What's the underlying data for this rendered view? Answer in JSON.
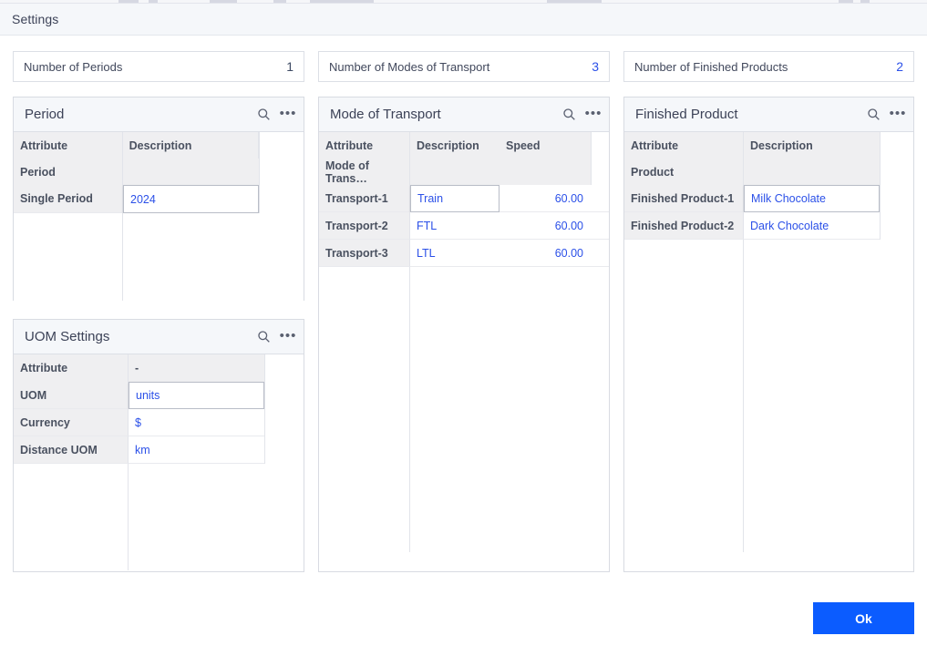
{
  "dialog": {
    "title": "Settings"
  },
  "counts": [
    {
      "label": "Number of Periods",
      "value": "1"
    },
    {
      "label": "Number of Modes of Transport",
      "value": "3"
    },
    {
      "label": "Number of Finished Products",
      "value": "2"
    }
  ],
  "panel_icons": {
    "search": "search-icon",
    "more": "more-options-icon"
  },
  "panels": {
    "period": {
      "title": "Period",
      "header_row1": [
        "Attribute",
        "Description"
      ],
      "header_row2": [
        "Period",
        ""
      ],
      "rows": [
        {
          "attribute": "Single Period",
          "description": "2024",
          "selected": true
        }
      ]
    },
    "transport": {
      "title": "Mode of Transport",
      "header_row1": [
        "Attribute",
        "Description",
        "Speed"
      ],
      "header_row2": [
        "Mode of Trans…",
        "",
        ""
      ],
      "rows": [
        {
          "attribute": "Transport-1",
          "description": "Train",
          "speed": "60.00",
          "selected": true
        },
        {
          "attribute": "Transport-2",
          "description": "FTL",
          "speed": "60.00",
          "selected": false
        },
        {
          "attribute": "Transport-3",
          "description": "LTL",
          "speed": "60.00",
          "selected": false
        }
      ]
    },
    "product": {
      "title": "Finished Product",
      "header_row1": [
        "Attribute",
        "Description"
      ],
      "header_row2": [
        "Product",
        ""
      ],
      "rows": [
        {
          "attribute": "Finished Product-1",
          "description": "Milk Chocolate",
          "selected": true
        },
        {
          "attribute": "Finished Product-2",
          "description": "Dark Chocolate",
          "selected": false
        }
      ]
    },
    "uom": {
      "title": "UOM Settings",
      "header_row1": [
        "Attribute",
        "-"
      ],
      "rows": [
        {
          "attribute": "UOM",
          "description": "units",
          "selected": true
        },
        {
          "attribute": "Currency",
          "description": "$",
          "selected": false
        },
        {
          "attribute": "Distance UOM",
          "description": "km",
          "selected": false
        }
      ]
    }
  },
  "footer": {
    "ok_label": "Ok"
  },
  "colors": {
    "accent": "#0b5cff",
    "link": "#2b50e8",
    "header_bg": "#efeff1",
    "panel_head_bg": "#f5f7fa",
    "border": "#d8dbe2"
  }
}
